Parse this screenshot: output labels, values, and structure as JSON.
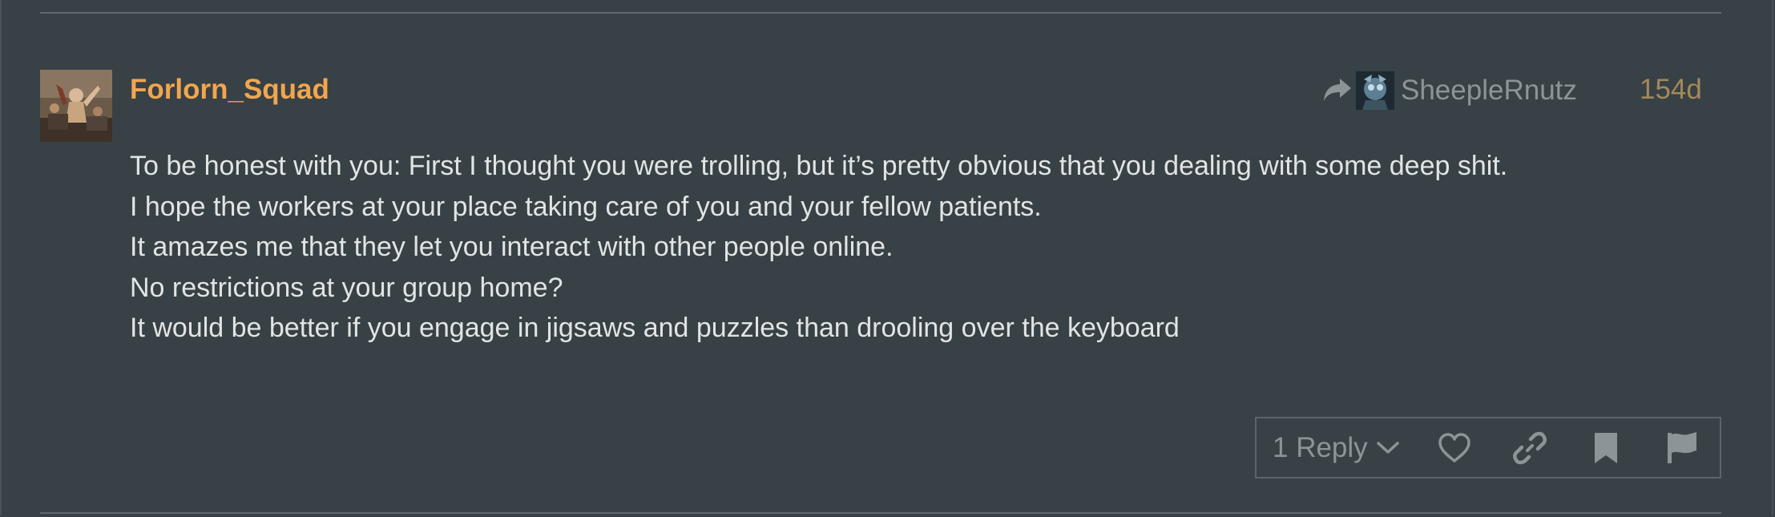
{
  "post": {
    "author": "Forlorn_Squad",
    "reply_to": {
      "name": "SheepleRnutz",
      "icon": "share-arrow-icon"
    },
    "date": "154d",
    "body_lines": [
      "To be honest with you: First I thought you were trolling, but it’s pretty obvious that you dealing with some deep shit.",
      "I hope the workers at your place taking care of you and your fellow patients.",
      "It amazes me that they let you interact with other people online.",
      "No restrictions at your group home?",
      "It would be better if you engage in jigsaws and puzzles than drooling over the keyboard"
    ],
    "actions": {
      "replies_label": "1 Reply",
      "icons": [
        "heart-icon",
        "link-icon",
        "bookmark-icon",
        "flag-icon"
      ]
    }
  },
  "colors": {
    "background": "#384145",
    "author": "#f0a650",
    "date": "#a3895c",
    "body_text": "#e1e4e5",
    "muted": "#8d9497"
  }
}
